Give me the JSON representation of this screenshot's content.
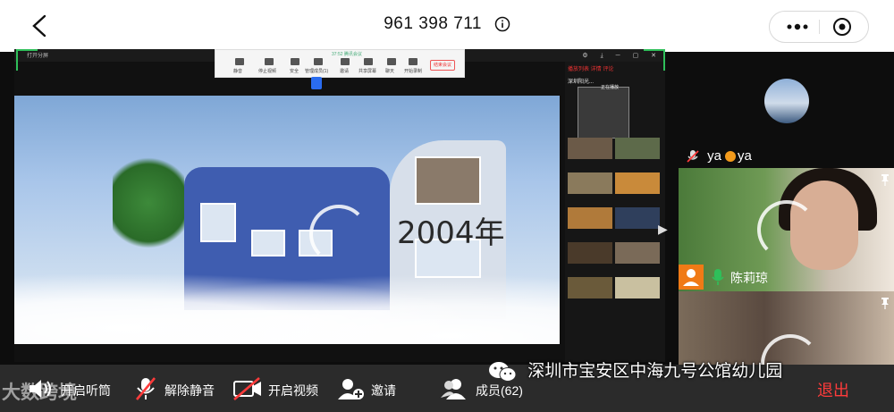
{
  "header": {
    "meeting_number": "961 398 711",
    "back_icon": "chevron-left-icon",
    "info_icon": "info-icon",
    "more_icon": "more-dots-icon",
    "close_icon": "target-icon"
  },
  "shared_screen": {
    "window_label": "打开分屏",
    "app_name": "腾讯会议",
    "timer": "37:52",
    "toolbar": [
      "静音",
      "停止视频",
      "安全",
      "管理成员(1)",
      "邀请",
      "共享屏幕",
      "聊天",
      "开始录制"
    ],
    "end_button": "结束会议",
    "video_caption": "2004年",
    "feed": {
      "tabs": "播放列表  详情  评论",
      "title": "深圳阳光...",
      "now_playing": "正在播放"
    }
  },
  "side_panel": {
    "participant_a": "ya",
    "participant_a_suffix": "ya",
    "participant_b": "陈莉琼"
  },
  "bottom_bar": {
    "speaker": "开启听筒",
    "unmute": "解除静音",
    "video": "开启视频",
    "invite": "邀请",
    "members": "成员(62)",
    "leave": "退出"
  },
  "watermark": {
    "channel": "深圳市宝安区中海九号公馆幼儿园",
    "left_logo": "大数跨境"
  },
  "colors": {
    "accent": "#2fbf5a",
    "leave": "#ff3b3b",
    "mic_off": "#ff3b3b",
    "orange": "#f07a16"
  }
}
